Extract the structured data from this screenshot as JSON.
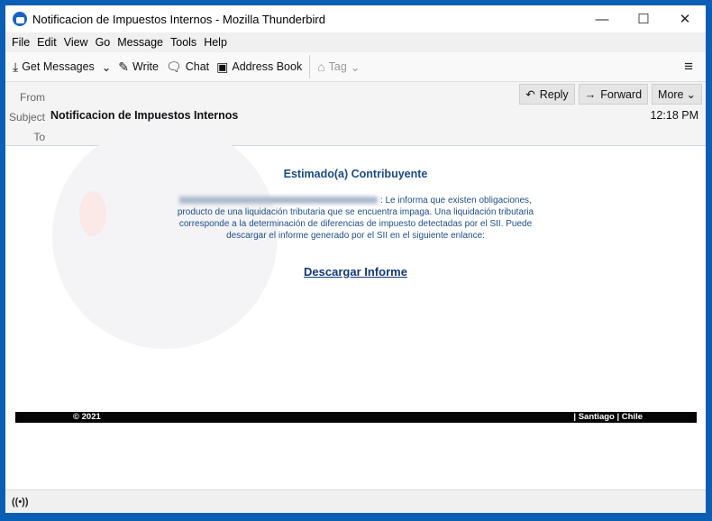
{
  "window": {
    "title": "Notificacion de Impuestos Internos - Mozilla Thunderbird",
    "controls": {
      "minimize": "—",
      "maximize": "☐",
      "close": "✕"
    }
  },
  "menu": [
    "File",
    "Edit",
    "View",
    "Go",
    "Message",
    "Tools",
    "Help"
  ],
  "toolbar": {
    "get_messages": "Get Messages",
    "write": "Write",
    "chat": "Chat",
    "address_book": "Address Book",
    "tag": "Tag"
  },
  "header": {
    "from_label": "From",
    "subject_label": "Subject",
    "to_label": "To",
    "subject": "Notificacion de Impuestos Internos",
    "time": "12:18 PM",
    "reply": "Reply",
    "forward": "Forward",
    "more": "More"
  },
  "email": {
    "greeting": "Estimado(a) Contribuyente",
    "paragraph": ": Le informa que existen obligaciones, producto de una liquidación tributaria que se encuentra impaga. Una liquidación tributaria corresponde a la determinación de diferencias de impuesto detectadas por el SII.   Puede descargar el informe generado por el SII en el siguiente enlance:",
    "link": "Descargar Informe",
    "footer_copy": "© 2021",
    "footer_location": "| Santiago | Chile"
  },
  "colors": {
    "heading": "#1a4b86",
    "link": "#12387a",
    "window_frame": "#0a5fb4"
  }
}
